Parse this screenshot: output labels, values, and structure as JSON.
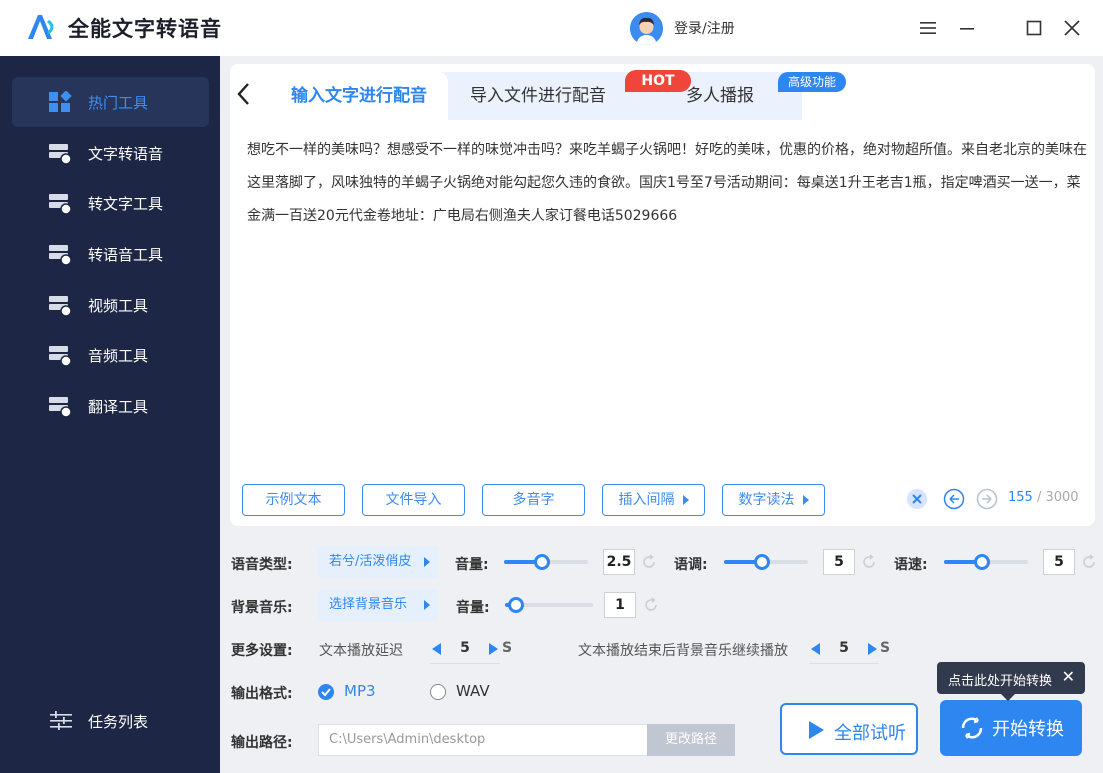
{
  "app": {
    "title": "全能文字转语音",
    "login_label": "登录/注册"
  },
  "sidebar": {
    "items": [
      {
        "label": "热门工具",
        "icon": "grid-icon"
      },
      {
        "label": "文字转语音",
        "icon": "server-icon"
      },
      {
        "label": "转文字工具",
        "icon": "server-icon"
      },
      {
        "label": "转语音工具",
        "icon": "server-icon"
      },
      {
        "label": "视频工具",
        "icon": "server-icon"
      },
      {
        "label": "音频工具",
        "icon": "server-icon"
      },
      {
        "label": "翻译工具",
        "icon": "server-icon"
      }
    ],
    "task_list_label": "任务列表"
  },
  "tabs": [
    {
      "label": "输入文字进行配音"
    },
    {
      "label": "导入文件进行配音"
    },
    {
      "label": "多人播报"
    }
  ],
  "badges": {
    "hot": "HOT",
    "advanced": "高级功能"
  },
  "editor": {
    "text": "想吃不一样的美味吗？想感受不一样的味觉冲击吗？来吃羊蝎子火锅吧！好吃的美味，优惠的价格，绝对物超所值。来自老北京的美味在这里落脚了，风味独特的羊蝎子火锅绝对能勾起您久违的食欲。国庆1号至7号活动期间：每桌送1升王老吉1瓶，指定啤酒买一送一，菜金满一百送20元代金卷地址：广电局右侧渔夫人家订餐电话5029666",
    "char_count": "155",
    "char_max": "3000",
    "tools": [
      "示例文本",
      "文件导入",
      "多音字",
      "插入间隔",
      "数字读法"
    ]
  },
  "settings": {
    "voice_type_label": "语音类型:",
    "voice_type_value": "若兮/活泼俏皮",
    "volume_label": "音量:",
    "volume_value": "2.5",
    "volume_level": 0.45,
    "pitch_label": "语调:",
    "pitch_value": "5",
    "pitch_level": 0.45,
    "speed_label": "语速:",
    "speed_value": "5",
    "speed_level": 0.45,
    "bgm_label": "背景音乐:",
    "bgm_value": "选择背景音乐",
    "bgm_volume_label": "音量:",
    "bgm_volume_value": "1",
    "bgm_volume_level": 0.12,
    "more_label": "更多设置:",
    "delay_label": "文本播放延迟",
    "delay_value": "5",
    "delay_unit": "S",
    "continue_label": "文本播放结束后背景音乐继续播放",
    "continue_value": "5",
    "continue_unit": "S",
    "format_label": "输出格式:",
    "format_options": [
      "MP3",
      "WAV"
    ],
    "format_selected": "MP3",
    "path_label": "输出路径:",
    "path_value": "C:\\Users\\Admin\\desktop",
    "change_path_label": "更改路径"
  },
  "actions": {
    "preview_label": "全部试听",
    "convert_label": "开始转换",
    "tooltip_text": "点击此处开始转换"
  },
  "colors": {
    "accent": "#2e86f0",
    "sidebar_bg": "#1d2745",
    "hot_badge": "#f0453a"
  }
}
